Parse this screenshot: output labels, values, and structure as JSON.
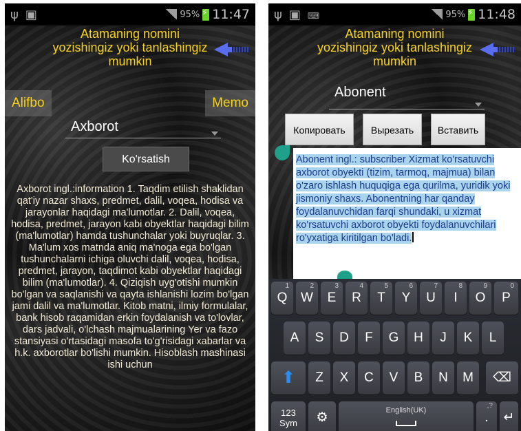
{
  "left": {
    "status": {
      "battery_pct": "95%",
      "time": "11:47"
    },
    "prompt_lines": [
      "Atamaning nomini",
      "yozishingiz yoki tanlashingiz",
      "mumkin"
    ],
    "alifbo_label": "Alifbo",
    "memo_label": "Memo",
    "dropdown_value": "Axborot",
    "show_button_label": "Ko'rsatish",
    "body_text": "Axborot ingl.:information 1. Taqdim etilish shaklidan qat'iy nazar shaxs, predmet, dalil, voqea, hodisa va jarayonlar haqidagi ma'lumotlar. 2. Dalil, voqea, hodisa, predmet, jarayon kabi obyektlar haqidagi bilim (ma'lumotlar) hamda tushunchalar yoki buyruqlar. 3. Ma'lum xos matnda aniq ma'noga ega bo'lgan tushunchalarni ichiga oluvchi dalil, voqea, hodisa, predmet, jarayon, taqdimot kabi obyektlar haqidagi bilim (ma'lumotlar). 4. Qiziqish uyg'otishi mumkin bo'lgan va saqlanishi va qayta ishlanishi lozim bo'lgan jami dalil va ma'lumotlar. Kitob matni, ilmiy formulalar, bank hisob raqamidan erkin foydalanish va to'lovlar, dars jadvali, o'lchash majmualarining Yer va fazo stansiyasi o'rtasidagi masofa to'g'risidagi xabarlar va h.k. axborotlar bo'lishi mumkin. Hisoblash mashinasi ishi uchun"
  },
  "right": {
    "status": {
      "battery_pct": "95%",
      "time": "11:48"
    },
    "prompt_lines": [
      "Atamaning nomini",
      "yozishingiz yoki tanlashingiz",
      "mumkin"
    ],
    "dropdown_value": "Abonent",
    "context_menu": {
      "copy": "Копировать",
      "cut": "Вырезать",
      "paste": "Вставить"
    },
    "selected_text": "Abonent ingl.: subscriber Xizmat ko'rsatuvchi axborot obyekti (tizim, tarmoq, majmua) bilan o'zaro ishlash huquqiga ega qurilma, yuridik yoki jismoniy shaxs. Abonentning har qanday foydalanuvchidan farqi shundaki, u xizmat ko'rsatuvchi axborot obyekti foydalanuvchilari ro'yxatiga kiritilgan bo'ladi.",
    "keyboard": {
      "row1": [
        {
          "k": "Q",
          "s": "1"
        },
        {
          "k": "W",
          "s": "2"
        },
        {
          "k": "E",
          "s": "3"
        },
        {
          "k": "R",
          "s": "4"
        },
        {
          "k": "T",
          "s": "5"
        },
        {
          "k": "Y",
          "s": "6"
        },
        {
          "k": "U",
          "s": "7"
        },
        {
          "k": "I",
          "s": "8"
        },
        {
          "k": "O",
          "s": "9"
        },
        {
          "k": "P",
          "s": "0"
        }
      ],
      "row2": [
        "A",
        "S",
        "D",
        "F",
        "G",
        "H",
        "J",
        "K",
        "L"
      ],
      "row3": [
        "Z",
        "X",
        "C",
        "V",
        "B",
        "N",
        "M"
      ],
      "sym_label_1": "123",
      "sym_label_2": "Sym",
      "space_label": "English(UK)",
      "dot_label": ".",
      "dot_sup": ",?"
    }
  },
  "colors": {
    "accent": "#f7d21a",
    "selection": "#a8d4ee",
    "handle": "#1fa08a",
    "shift": "#2d8cf0"
  }
}
